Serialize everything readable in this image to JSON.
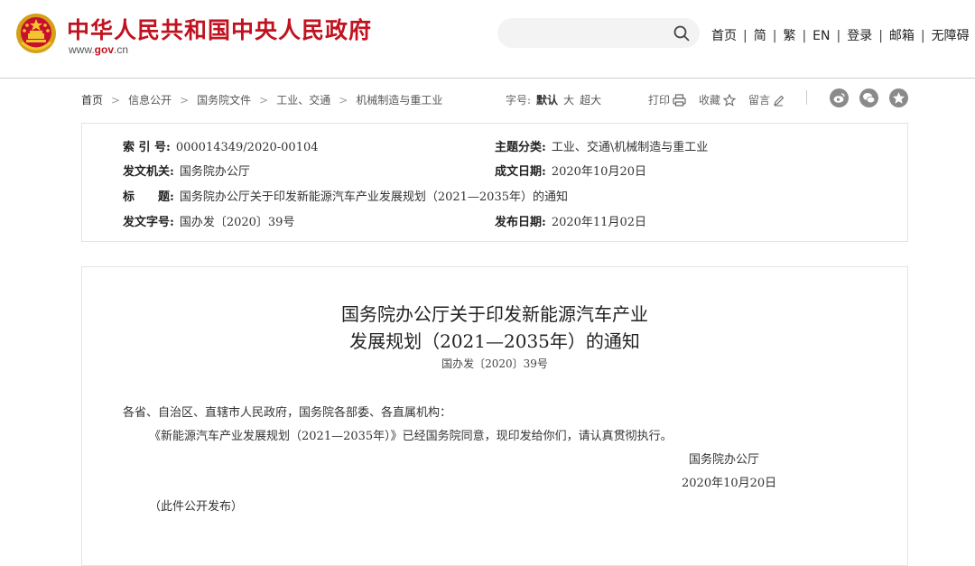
{
  "header": {
    "site_title": "中华人民共和国中央人民政府",
    "domain_prefix": "www.",
    "domain_brand": "gov",
    "domain_suffix": ".cn",
    "search_placeholder": "",
    "nav": [
      "首页",
      "简",
      "繁",
      "EN",
      "登录",
      "邮箱",
      "无障碍"
    ],
    "brand_color": "#c1121f"
  },
  "breadcrumb": {
    "items": [
      "首页",
      "信息公开",
      "国务院文件",
      "工业、交通",
      "机械制造与重工业"
    ],
    "separator": ">"
  },
  "toolbar": {
    "font_label": "字号:",
    "font_options": [
      "默认",
      "大",
      "超大"
    ],
    "print": "打印",
    "favorite": "收藏",
    "comment": "留言",
    "share_icons": [
      "weibo-icon",
      "wechat-icon",
      "qzone-icon"
    ]
  },
  "meta": {
    "index_label": "索 引 号:",
    "index_value": "000014349/2020-00104",
    "topic_label": "主题分类:",
    "topic_value": "工业、交通\\机械制造与重工业",
    "issuer_label": "发文机关:",
    "issuer_value": "国务院办公厅",
    "written_label": "成文日期:",
    "written_value": "2020年10月20日",
    "title_label": "标　　题:",
    "title_value": "国务院办公厅关于印发新能源汽车产业发展规划（2021—2035年）的通知",
    "docno_label": "发文字号:",
    "docno_value": "国办发〔2020〕39号",
    "published_label": "发布日期:",
    "published_value": "2020年11月02日"
  },
  "article": {
    "title_line1": "国务院办公厅关于印发新能源汽车产业",
    "title_line2": "发展规划（2021—2035年）的通知",
    "doc_number": "国办发〔2020〕39号",
    "recipients": "各省、自治区、直辖市人民政府，国务院各部委、各直属机构：",
    "paragraph": "《新能源汽车产业发展规划（2021—2035年）》已经国务院同意，现印发给你们，请认真贯彻执行。",
    "signature": "国务院办公厅",
    "date": "2020年10月20日",
    "note": "（此件公开发布）"
  }
}
